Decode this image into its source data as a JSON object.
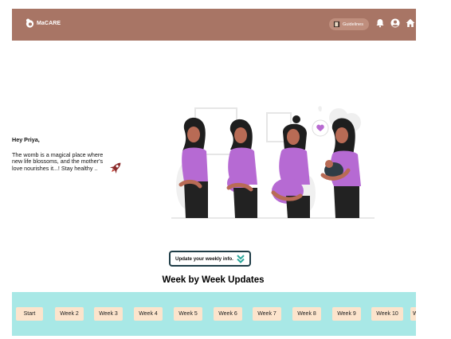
{
  "navbar": {
    "brand": "MaCARE",
    "guidelines_label": "Guidelines",
    "accent_color": "#a87565",
    "icons": [
      "logo-icon",
      "book-icon",
      "bell-icon",
      "user-icon",
      "home-icon"
    ]
  },
  "hero": {
    "greeting": "Hey Priya,",
    "message": "The womb is a magical place where new life blossoms, and the mother's love nourishes it...! Stay healthy ..",
    "icons": [
      "rocket-icon",
      "pregnancy-illustration"
    ]
  },
  "update_button": {
    "label": "Update your weekly info."
  },
  "weekly": {
    "title": "Week by Week Updates",
    "strip_color": "#a8e8e6",
    "items": [
      "Start",
      "Week 2",
      "Week 3",
      "Week 4",
      "Week 5",
      "Week 6",
      "Week 7",
      "Week 8",
      "Week 9",
      "Week 10",
      "W"
    ]
  }
}
